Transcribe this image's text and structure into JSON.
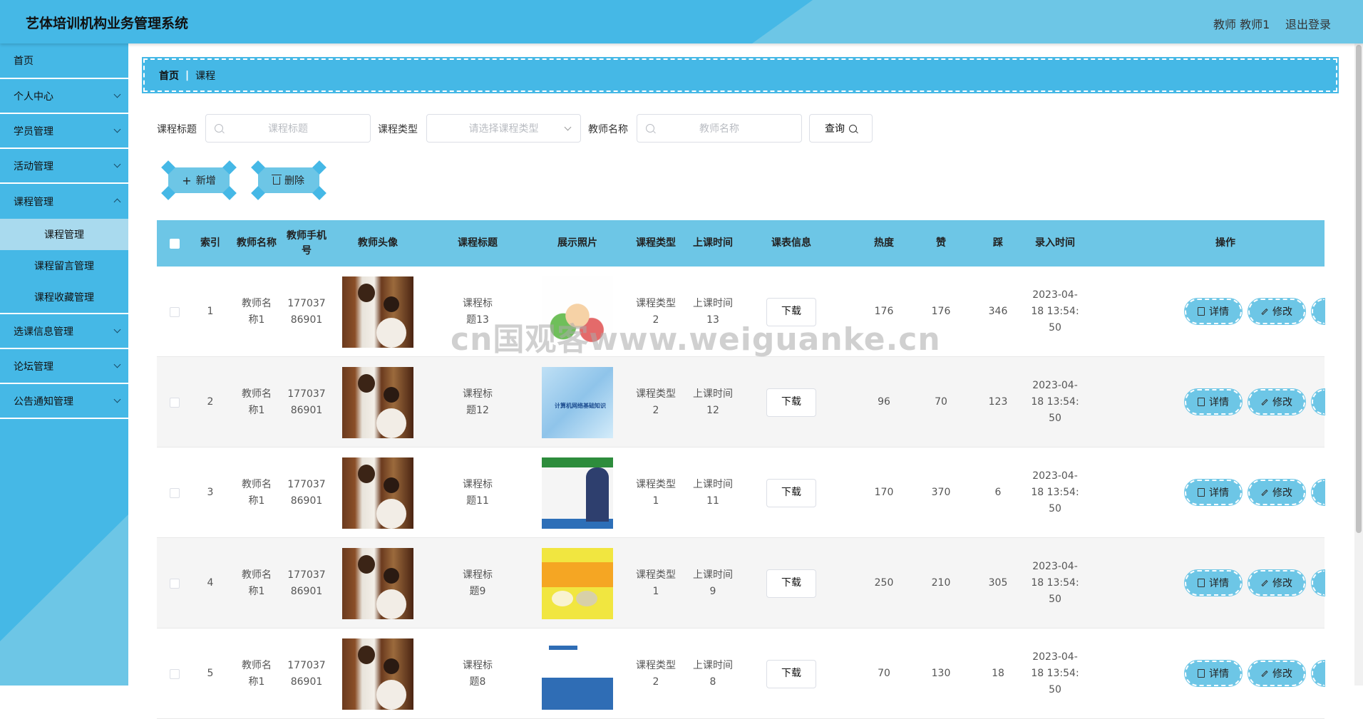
{
  "app": {
    "title": "艺体培训机构业务管理系统",
    "user_label": "教师 教师1",
    "logout_label": "退出登录"
  },
  "sidebar": {
    "items": [
      {
        "label": "首页",
        "has_children": false
      },
      {
        "label": "个人中心",
        "has_children": true
      },
      {
        "label": "学员管理",
        "has_children": true
      },
      {
        "label": "活动管理",
        "has_children": true
      },
      {
        "label": "课程管理",
        "has_children": true,
        "expanded": true
      },
      {
        "label": "选课信息管理",
        "has_children": true
      },
      {
        "label": "论坛管理",
        "has_children": true
      },
      {
        "label": "公告通知管理",
        "has_children": true
      }
    ],
    "subitems": [
      "课程管理",
      "课程留言管理",
      "课程收藏管理"
    ],
    "active_subitem": "课程管理"
  },
  "breadcrumb": {
    "home": "首页",
    "current": "课程"
  },
  "search": {
    "title_label": "课程标题",
    "title_placeholder": "课程标题",
    "type_label": "课程类型",
    "type_placeholder": "请选择课程类型",
    "teacher_label": "教师名称",
    "teacher_placeholder": "教师名称",
    "query_label": "查询"
  },
  "actions": {
    "add_label": "新增",
    "delete_label": "删除"
  },
  "table": {
    "headers": {
      "index": "索引",
      "teacher_name": "教师名称",
      "teacher_phone": "教师手机号",
      "teacher_avatar": "教师头像",
      "course_title": "课程标题",
      "photo": "展示照片",
      "course_type": "课程类型",
      "class_time": "上课时间",
      "schedule": "课表信息",
      "heat": "热度",
      "likes": "赞",
      "dislikes": "踩",
      "created": "录入时间",
      "ops": "操作"
    },
    "download_label": "下载",
    "detail_label": "详情",
    "edit_label": "修改",
    "photo2_caption": "计算机网络基础知识",
    "rows": [
      {
        "index": "1",
        "teacher_name": "教师名称1",
        "teacher_phone": "17703786901",
        "course_title": "课程标题13",
        "course_type": "课程类型2",
        "class_time": "上课时间13",
        "heat": "176",
        "likes": "176",
        "dislikes": "346",
        "created": "2023-04-18 13:54:50"
      },
      {
        "index": "2",
        "teacher_name": "教师名称1",
        "teacher_phone": "17703786901",
        "course_title": "课程标题12",
        "course_type": "课程类型2",
        "class_time": "上课时间12",
        "heat": "96",
        "likes": "70",
        "dislikes": "123",
        "created": "2023-04-18 13:54:50"
      },
      {
        "index": "3",
        "teacher_name": "教师名称1",
        "teacher_phone": "17703786901",
        "course_title": "课程标题11",
        "course_type": "课程类型1",
        "class_time": "上课时间11",
        "heat": "170",
        "likes": "370",
        "dislikes": "6",
        "created": "2023-04-18 13:54:50"
      },
      {
        "index": "4",
        "teacher_name": "教师名称1",
        "teacher_phone": "17703786901",
        "course_title": "课程标题9",
        "course_type": "课程类型1",
        "class_time": "上课时间9",
        "heat": "250",
        "likes": "210",
        "dislikes": "305",
        "created": "2023-04-18 13:54:50"
      },
      {
        "index": "5",
        "teacher_name": "教师名称1",
        "teacher_phone": "17703786901",
        "course_title": "课程标题8",
        "course_type": "课程类型2",
        "class_time": "上课时间8",
        "heat": "70",
        "likes": "130",
        "dislikes": "18",
        "created": "2023-04-18 13:54:50"
      }
    ]
  },
  "watermark": "cn国观客www.weiguanke.cn",
  "colors": {
    "primary": "#45b8e6",
    "light": "#6dc6e6",
    "active_sub": "#a9daee"
  }
}
